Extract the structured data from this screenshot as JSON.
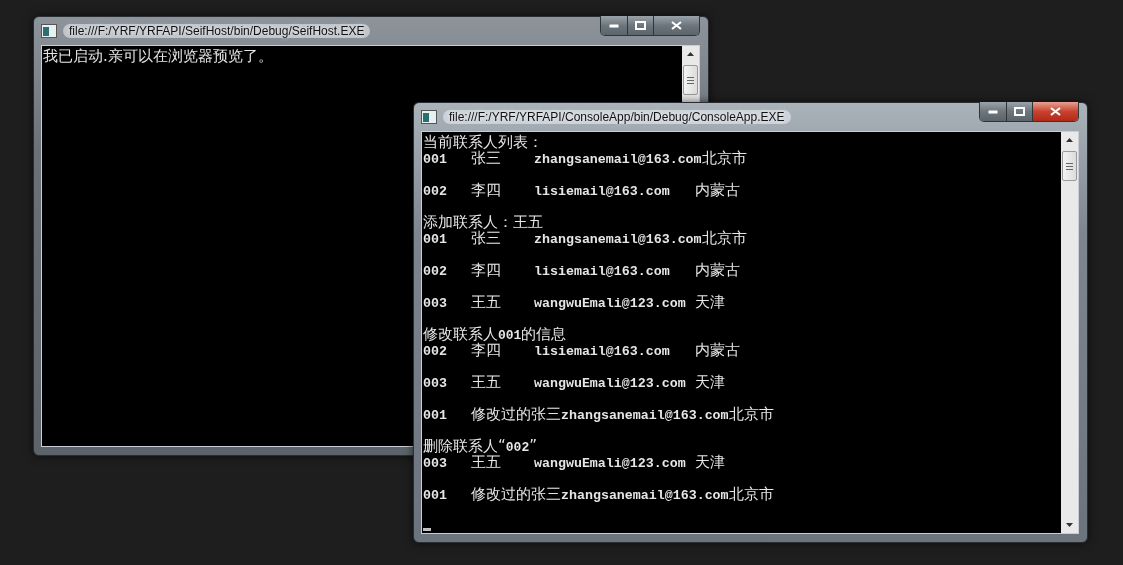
{
  "windows": [
    {
      "title": "file:///F:/YRF/YRFAPI/SeifHost/bin/Debug/SeifHost.EXE",
      "active": false,
      "cursor": false,
      "lines": [
        {
          "kind": "text",
          "text": "我已启动.亲可以在浏览器预览了。"
        }
      ]
    },
    {
      "title": "file:///F:/YRF/YRFAPI/ConsoleApp/bin/Debug/ConsoleApp.EXE",
      "active": true,
      "cursor": true,
      "lines": [
        {
          "kind": "text",
          "text": "当前联系人列表："
        },
        {
          "kind": "row",
          "cells": [
            "001",
            "张三",
            "zhangsanemail@163.com",
            "北京市"
          ]
        },
        {
          "kind": "row",
          "cells": [
            "002",
            "李四",
            "lisiemail@163.com",
            "内蒙古"
          ]
        },
        {
          "kind": "text",
          "text": "添加联系人：王五"
        },
        {
          "kind": "row",
          "cells": [
            "001",
            "张三",
            "zhangsanemail@163.com",
            "北京市"
          ]
        },
        {
          "kind": "row",
          "cells": [
            "002",
            "李四",
            "lisiemail@163.com",
            "内蒙古"
          ]
        },
        {
          "kind": "row",
          "cells": [
            "003",
            "王五",
            "wangwuEmali@123.com",
            "天津"
          ]
        },
        {
          "kind": "text",
          "text": "修改联系人**001**的信息"
        },
        {
          "kind": "row",
          "cells": [
            "002",
            "李四",
            "lisiemail@163.com",
            "内蒙古"
          ]
        },
        {
          "kind": "row",
          "cells": [
            "003",
            "王五",
            "wangwuEmali@123.com",
            "天津"
          ]
        },
        {
          "kind": "row",
          "cells": [
            "001",
            "修改过的张三",
            "zhangsanemail@163.com",
            "北京市"
          ]
        },
        {
          "kind": "text",
          "text": "删除联系人“**002**”"
        },
        {
          "kind": "row",
          "cells": [
            "003",
            "王五",
            "wangwuEmali@123.com",
            "天津"
          ]
        },
        {
          "kind": "row",
          "cells": [
            "001",
            "修改过的张三",
            "zhangsanemail@163.com",
            "北京市"
          ]
        }
      ]
    }
  ]
}
